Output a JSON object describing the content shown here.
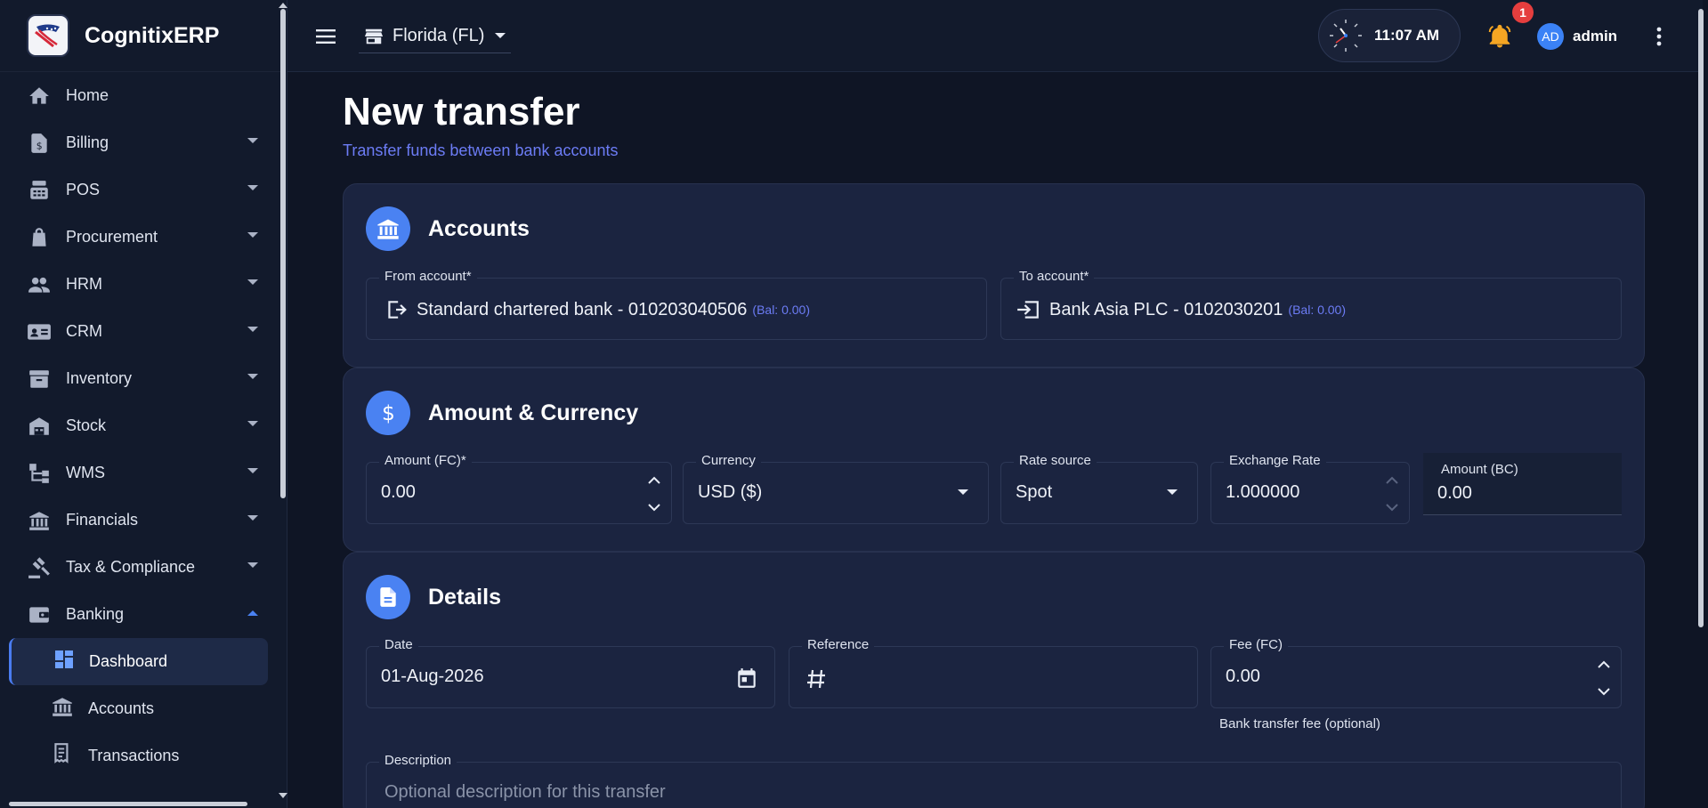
{
  "brand": {
    "name": "CognitixERP"
  },
  "topbar": {
    "store": "Florida (FL)",
    "time": "11:07 AM",
    "notifications": "1",
    "user_initials": "AD",
    "user_name": "admin"
  },
  "sidebar": {
    "items": [
      {
        "label": "Home"
      },
      {
        "label": "Billing"
      },
      {
        "label": "POS"
      },
      {
        "label": "Procurement"
      },
      {
        "label": "HRM"
      },
      {
        "label": "CRM"
      },
      {
        "label": "Inventory"
      },
      {
        "label": "Stock"
      },
      {
        "label": "WMS"
      },
      {
        "label": "Financials"
      },
      {
        "label": "Tax & Compliance"
      },
      {
        "label": "Banking"
      }
    ],
    "banking_sub": [
      {
        "label": "Dashboard"
      },
      {
        "label": "Accounts"
      },
      {
        "label": "Transactions"
      }
    ]
  },
  "page": {
    "title": "New transfer",
    "subtitle": "Transfer funds between bank accounts"
  },
  "accounts": {
    "title": "Accounts",
    "from_label": "From account*",
    "from_value": "Standard chartered bank - 010203040506",
    "from_balance": "(Bal: 0.00)",
    "to_label": "To account*",
    "to_value": "Bank Asia PLC - 0102030201",
    "to_balance": "(Bal: 0.00)"
  },
  "amount": {
    "title": "Amount & Currency",
    "amount_fc_label": "Amount (FC)*",
    "amount_fc_value": "0.00",
    "currency_label": "Currency",
    "currency_value": "USD ($)",
    "rate_source_label": "Rate source",
    "rate_source_value": "Spot",
    "exchange_rate_label": "Exchange Rate",
    "exchange_rate_value": "1.000000",
    "amount_bc_label": "Amount (BC)",
    "amount_bc_value": "0.00"
  },
  "details": {
    "title": "Details",
    "date_label": "Date",
    "date_value": "01-Aug-2026",
    "reference_label": "Reference",
    "fee_label": "Fee (FC)",
    "fee_value": "0.00",
    "fee_helper": "Bank transfer fee (optional)",
    "description_label": "Description",
    "description_placeholder": "Optional description for this transfer"
  },
  "colors": {
    "accent": "#4a82f2",
    "link": "#6c7cf5",
    "warning": "#f5a623",
    "badge": "#e53e3e"
  }
}
